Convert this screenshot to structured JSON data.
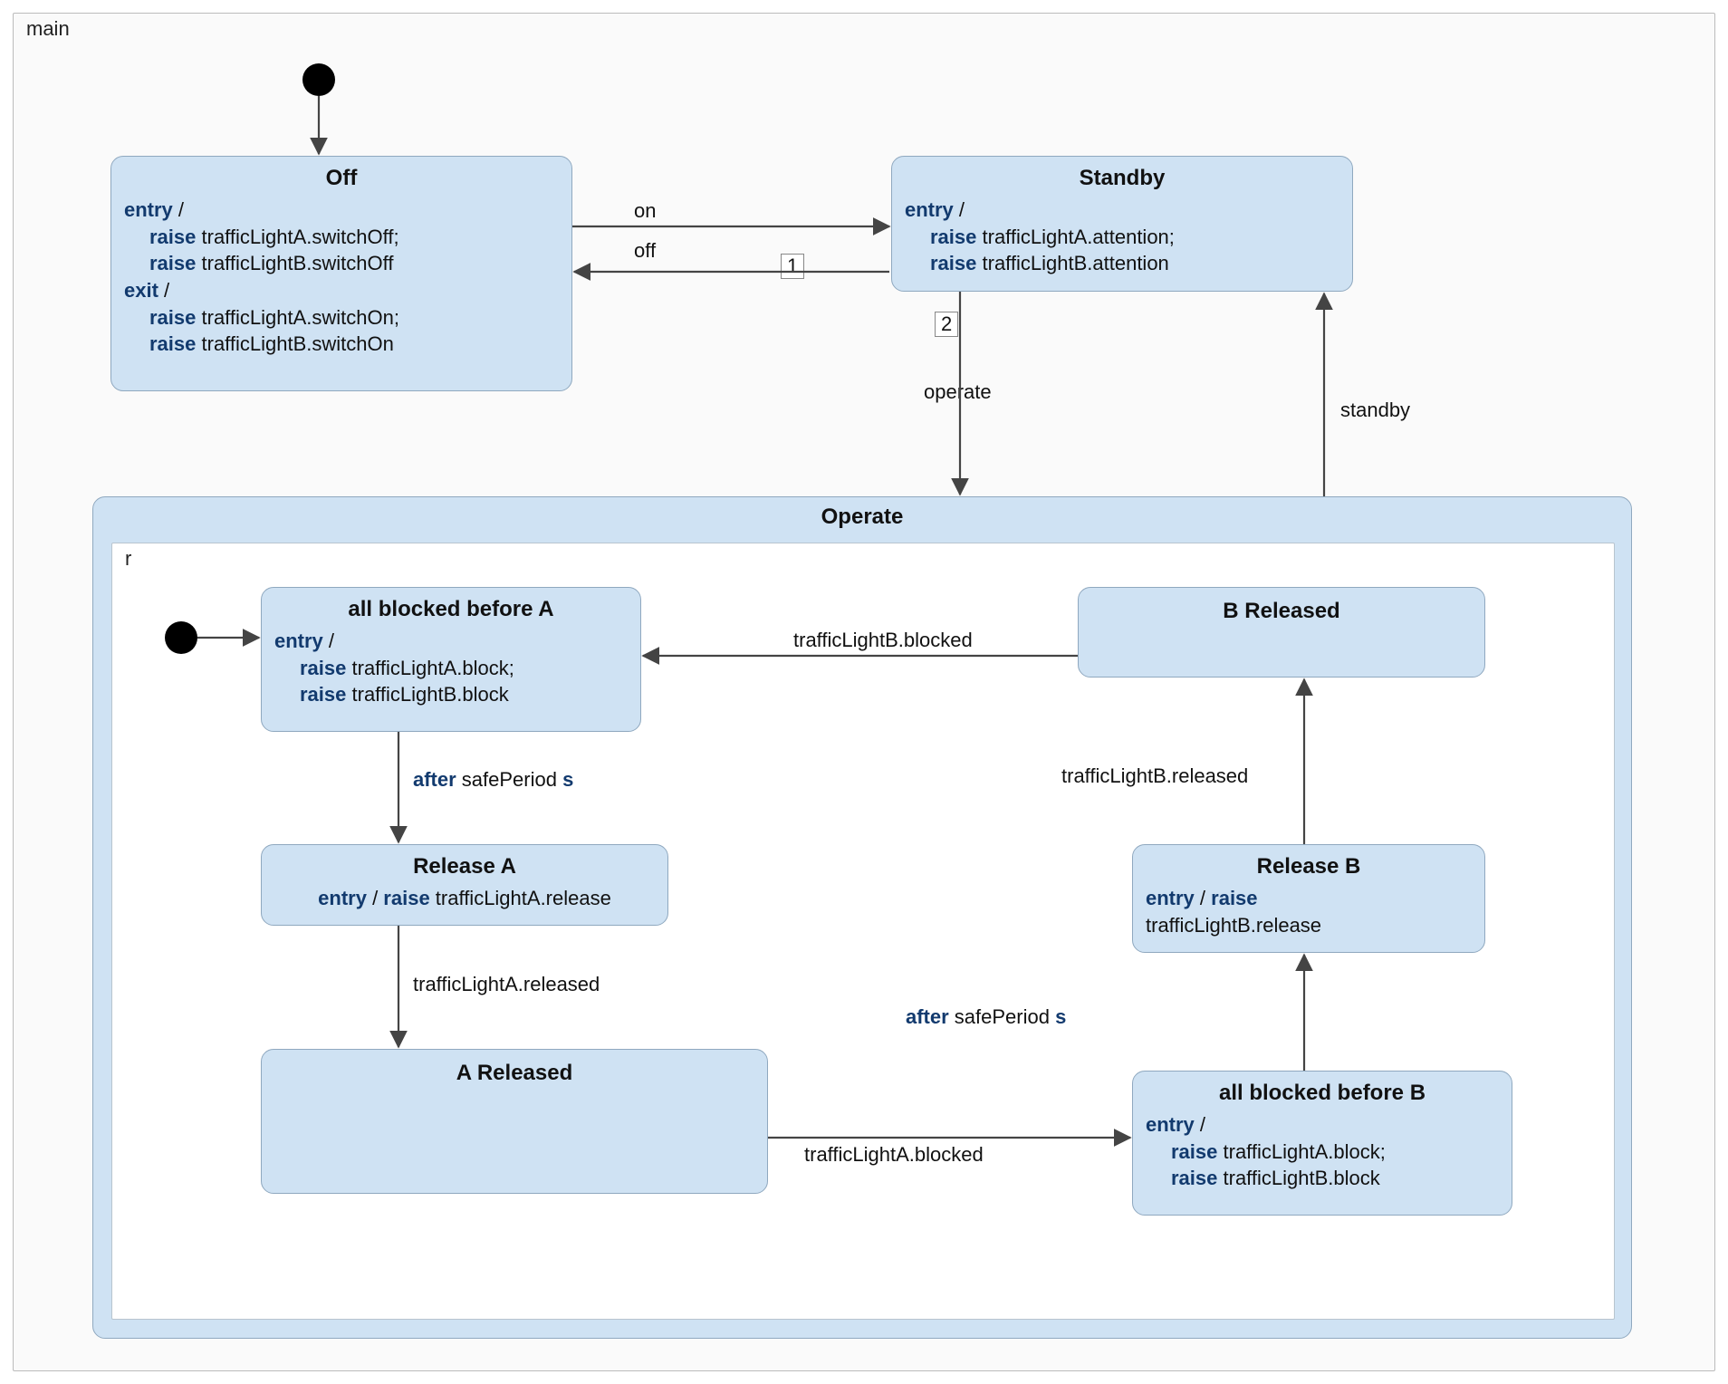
{
  "regions": {
    "main": {
      "label": "main"
    },
    "r": {
      "label": "r"
    }
  },
  "states": {
    "off": {
      "title": "Off",
      "entryLabel": "entry",
      "entry1_kw": "raise",
      "entry1_rest": " trafficLightA.switchOff;",
      "entry2_kw": "raise",
      "entry2_rest": " trafficLightB.switchOff",
      "exitLabel": "exit",
      "exit1_kw": "raise",
      "exit1_rest": " trafficLightA.switchOn;",
      "exit2_kw": "raise",
      "exit2_rest": " trafficLightB.switchOn"
    },
    "standby": {
      "title": "Standby",
      "entryLabel": "entry",
      "entry1_kw": "raise",
      "entry1_rest": " trafficLightA.attention;",
      "entry2_kw": "raise",
      "entry2_rest": " trafficLightB.attention"
    },
    "operate": {
      "title": "Operate"
    },
    "allBlockedA": {
      "title": "all blocked before A",
      "entryLabel": "entry",
      "entry1_kw": "raise",
      "entry1_rest": " trafficLightA.block;",
      "entry2_kw": "raise",
      "entry2_rest": " trafficLightB.block"
    },
    "releaseA": {
      "title": "Release A",
      "entryLabel": "entry",
      "entry_kw": "raise",
      "entry_rest": " trafficLightA.release"
    },
    "aReleased": {
      "title": "A Released"
    },
    "allBlockedB": {
      "title": "all blocked before B",
      "entryLabel": "entry",
      "entry1_kw": "raise",
      "entry1_rest": " trafficLightA.block;",
      "entry2_kw": "raise",
      "entry2_rest": " trafficLightB.block"
    },
    "releaseB": {
      "title": "Release B",
      "entryLabel": "entry",
      "entry_kw": "raise",
      "entry_rest": "trafficLightB.release"
    },
    "bReleased": {
      "title": "B Released"
    }
  },
  "transitions": {
    "on_label": "on",
    "off_label": "off",
    "operate_label": "operate",
    "standby_label": "standby",
    "prio1": "1",
    "prio2": "2",
    "after_kw": "after",
    "safePeriod": " safePeriod ",
    "s_kw": "s",
    "tA_released": "trafficLightA.released",
    "tA_blocked": "trafficLightA.blocked",
    "tB_released": "trafficLightB.released",
    "tB_blocked": "trafficLightB.blocked"
  }
}
